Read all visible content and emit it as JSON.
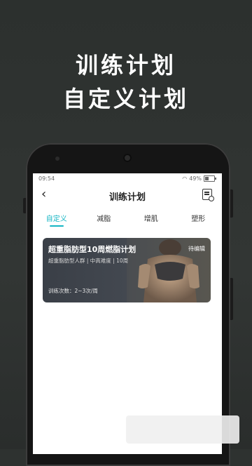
{
  "promo": {
    "line1": "训练计划",
    "line2": "自定义计划"
  },
  "status_bar": {
    "time": "09:54",
    "battery": "49%"
  },
  "nav": {
    "title": "训练计划"
  },
  "tabs": [
    {
      "label": "自定义",
      "active": true
    },
    {
      "label": "减脂",
      "active": false
    },
    {
      "label": "增肌",
      "active": false
    },
    {
      "label": "塑形",
      "active": false
    }
  ],
  "plan_card": {
    "title": "超重脂肪型10周燃脂计划",
    "status": "待编辑",
    "subtitle": "超重脂肪型人群 | 中高难度 | 10周",
    "count": "训练次数：2~3次/周"
  },
  "colors": {
    "accent": "#15b6c4",
    "background": "#2e3230"
  }
}
